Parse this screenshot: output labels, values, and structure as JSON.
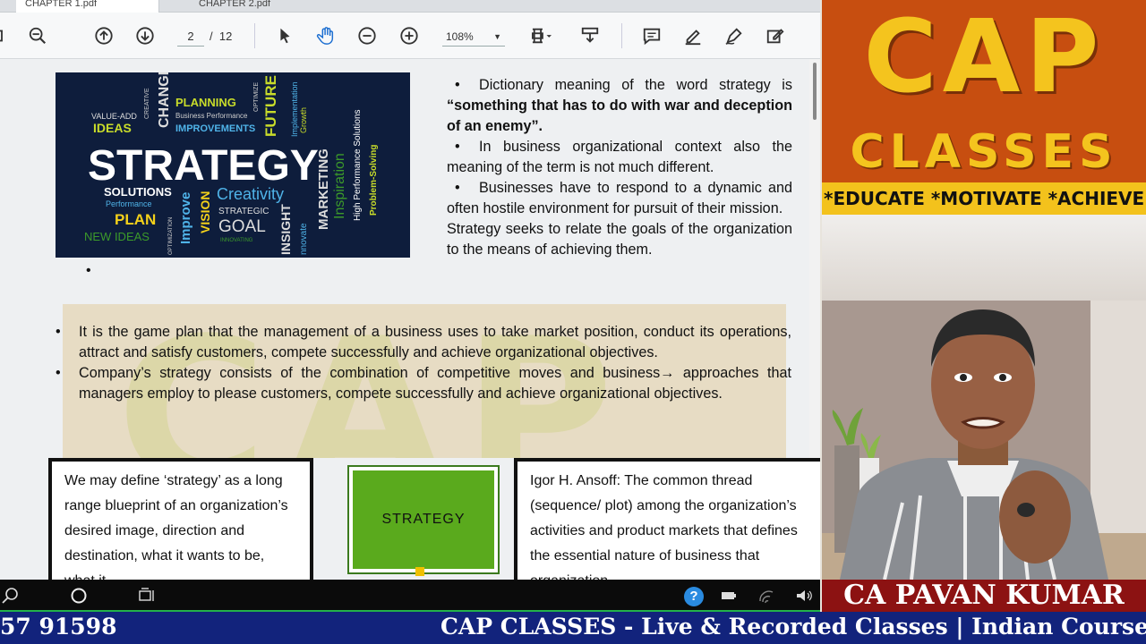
{
  "tabs": [
    "CHAPTER 1.pdf",
    "CHAPTER 2.pdf"
  ],
  "toolbar": {
    "page_current": "2",
    "page_sep": "/",
    "page_total": "12",
    "zoom": "108%"
  },
  "wordcloud": {
    "words": [
      "VALUE-ADD",
      "CREATIVE",
      "CHANGE",
      "PLANNING",
      "OPTIMIZE",
      "Implementation",
      "IDEAS",
      "Business Performance",
      "IMPROVEMENTS",
      "FUTURE",
      "Growth",
      "STRATEGY",
      "High Performance Solutions",
      "Problem-Solving",
      "Inspiration",
      "MARKETING",
      "SOLUTIONS",
      "Performance",
      "PLAN",
      "Improve",
      "VISION",
      "Creativity",
      "STRATEGIC",
      "GOAL",
      "INSIGHT",
      "nnovate",
      "NEW IDEAS",
      "OPTIMIZATION",
      "INNOVATING"
    ]
  },
  "right_text": {
    "p1_pre": "Dictionary meaning of the word strategy is ",
    "p1_bold": "“something that has to do with war and deception of an enemy”.",
    "p2": "In business organizational context also the meaning of the term is not much different.",
    "p3": "Businesses have to respond to a dynamic and often hostile environment for pursuit of their mission.",
    "p4": "Strategy seeks to relate the goals of the organization to the means of achieving them."
  },
  "lone_bullet": "•",
  "bullets": [
    "It is the game plan that the management of a business uses to take market position, conduct its operations, attract and satisfy customers, compete successfully and achieve organizational objectives.",
    "Company’s strategy consists of the combination of competitive moves and business→ approaches that managers employ to please customers, compete successfully and achieve organizational objectives."
  ],
  "box_left": {
    "text": "We may define ‘strategy’ as a long range blueprint of an organization’s desired image, direction and destination, what it wants to be, what it"
  },
  "strategy_box": {
    "label": "STRATEGY"
  },
  "box_right": {
    "text": "Igor H. Ansoff: The common thread (sequence/ plot) among the organization’s activities and product markets that defines the essential nature of business that organization"
  },
  "logo": {
    "cap": "CAP",
    "classes": "CLASSES",
    "tagline": "*EDUCATE *MOTIVATE *ACHIEVE"
  },
  "nameplate": "CA PAVAN KUMAR",
  "ticker": {
    "phone": "57 91598",
    "text": "CAP CLASSES - Live & Recorded Classes | Indian Courses"
  },
  "colors": {
    "logo_bg": "#c74e10",
    "logo_text": "#f4c41e",
    "nameplate_bg": "#8c1212",
    "ticker_bg": "#12237c",
    "strategy_green": "#5aaa1d"
  }
}
